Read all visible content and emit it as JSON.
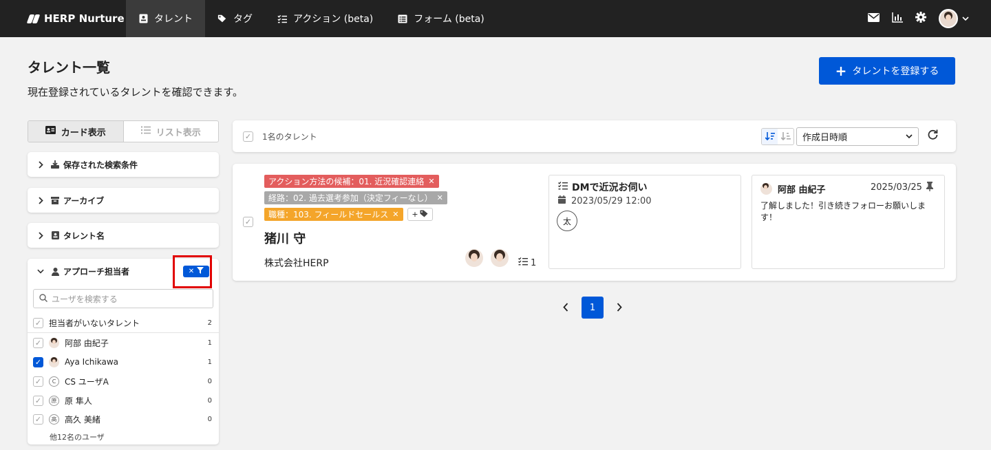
{
  "topnav": {
    "brand": "HERP Nurture",
    "items": [
      {
        "label": "タレント",
        "icon": "id-card-icon",
        "active": true
      },
      {
        "label": "タグ",
        "icon": "tag-icon",
        "active": false
      },
      {
        "label": "アクション (beta)",
        "icon": "checklist-icon",
        "active": false
      },
      {
        "label": "フォーム (beta)",
        "icon": "form-icon",
        "active": false
      }
    ],
    "right_icons": [
      "mail-icon",
      "chart-icon",
      "gear-icon",
      "avatar",
      "chevron-down-icon"
    ]
  },
  "header": {
    "title": "タレント一覧",
    "description": "現在登録されているタレントを確認できます。",
    "add_button": "タレントを登録する"
  },
  "view_toggle": {
    "card_label": "カード表示",
    "list_label": "リスト表示",
    "selected": "card"
  },
  "filters": {
    "saved": "保存された検索条件",
    "archive": "アーカイブ",
    "talent_name": "タレント名",
    "approach": {
      "label": "アプローチ担当者",
      "search_placeholder": "ユーザを検索する",
      "rows": [
        {
          "name": "担当者がいないタレント",
          "count": "2",
          "checked": false,
          "avatar": "none"
        },
        {
          "name": "阿部 由紀子",
          "count": "1",
          "checked": false,
          "avatar": "photo"
        },
        {
          "name": "Aya Ichikawa",
          "count": "1",
          "checked": true,
          "avatar": "photo"
        },
        {
          "name": "CS ユーザA",
          "count": "0",
          "checked": false,
          "avatar": "C"
        },
        {
          "name": "原 隼人",
          "count": "0",
          "checked": false,
          "avatar": "原"
        },
        {
          "name": "高久 美緒",
          "count": "0",
          "checked": false,
          "avatar": "高"
        }
      ],
      "more": "他12名のユーザ"
    }
  },
  "results": {
    "count_label": "1名のタレント",
    "sort_select": "作成日時順"
  },
  "talent_card": {
    "tags": [
      {
        "label": "アクション方法の候補：01. 近況確認連絡",
        "color": "#e35d5d"
      },
      {
        "label": "経路：02. 過去選考参加（決定フィーなし）",
        "color": "#a8a8a8"
      },
      {
        "label": "職種：103. フィールドセールス",
        "color": "#f4a52a"
      }
    ],
    "tag_add": "+",
    "name": "猪川 守",
    "company": "株式会社HERP",
    "action_count": "1",
    "action": {
      "title": "DMで近況お伺い",
      "datetime": "2023/05/29 12:00",
      "assignee_initial": "太"
    },
    "note": {
      "author": "阿部 由紀子",
      "date": "2025/03/25",
      "body": "了解しました！引き続きフォローお願いします！"
    }
  },
  "pagination": {
    "current": "1"
  }
}
